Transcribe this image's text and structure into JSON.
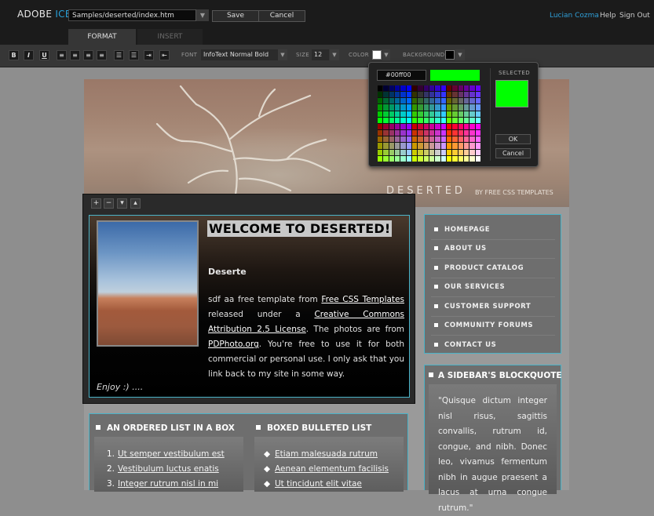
{
  "app": {
    "brand_main": "ADOBE",
    "brand_accent": "ICE",
    "url": "Samples/deserted/index.htm",
    "save_label": "Save",
    "cancel_label": "Cancel",
    "user_name": "Lucian Cozma",
    "help_label": "Help",
    "signout_label": "Sign Out"
  },
  "tabs": [
    {
      "label": "FORMAT",
      "active": true
    },
    {
      "label": "INSERT",
      "active": false
    }
  ],
  "toolbar": {
    "bold": "B",
    "italic": "I",
    "underline": "U",
    "font_label": "FONT",
    "font_value": "InfoText Normal Bold",
    "size_label": "SIZE",
    "size_value": "12",
    "color_label": "COLOR",
    "background_label": "BACKGROUND",
    "text_color": "#ffffff",
    "background_color": "#000000"
  },
  "color_picker": {
    "hex_value": "#00ff00",
    "selected_label": "SELECTED",
    "selected_color": "#00ff00",
    "ok_label": "OK",
    "cancel_label": "Cancel"
  },
  "site": {
    "title": "DESERTED",
    "subtitle": "BY FREE CSS TEMPLATES"
  },
  "editor_controls": [
    "+",
    "−",
    "▾",
    "▴"
  ],
  "main": {
    "heading": "WELCOME TO DESERTED!",
    "subheading": "Deserte",
    "para_1": "sdf aa free template from ",
    "link_1": "Free CSS Templates",
    "para_2": " released under a ",
    "link_2": "Creative Commons Attribution 2.5 License",
    "para_3": ". The photos are from ",
    "link_3": "PDPhoto.org",
    "para_4": ". You're free to use it for both commercial or personal use. I only ask that you link back to my site in some way.",
    "footer": "Enjoy :) ...."
  },
  "nav": [
    "HOMEPAGE",
    "ABOUT US",
    "PRODUCT CATALOG",
    "OUR SERVICES",
    "CUSTOMER SUPPORT",
    "COMMUNITY FORUMS",
    "CONTACT US"
  ],
  "quote": {
    "title": "A SIDEBAR'S BLOCKQUOTE",
    "text": "\"Quisque dictum integer nisl risus, sagittis convallis, rutrum id, congue, and nibh. Donec leo, vivamus fermentum nibh in augue praesent a lacus at urna congue rutrum.\""
  },
  "ordered_list": {
    "title": "AN ORDERED LIST IN A BOX",
    "items": [
      "Ut semper vestibulum est",
      "Vestibulum luctus enatis",
      "Integer rutrum nisl in mi"
    ]
  },
  "bulleted_list": {
    "title": "BOXED BULLETED LIST",
    "items": [
      "Etiam malesuada rutrum",
      "Aenean elementum facilisis",
      "Ut tincidunt elit vitae"
    ]
  }
}
